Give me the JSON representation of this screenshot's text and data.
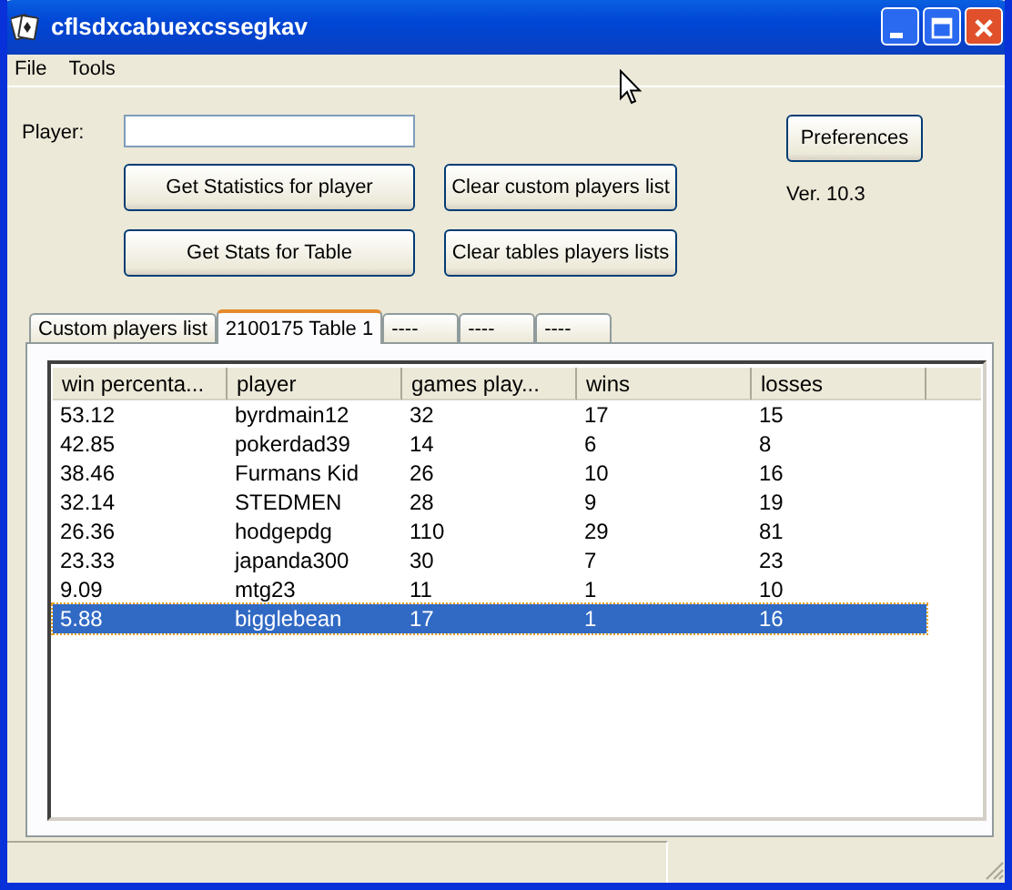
{
  "window": {
    "title": "cflsdxcabuexcssegkav"
  },
  "menu": [
    "File",
    "Tools"
  ],
  "player_field": {
    "label": "Player:"
  },
  "buttons": [
    {
      "label": "Get Statistics for player"
    },
    {
      "label": "Clear custom players list"
    },
    {
      "label": "Get Stats for Table"
    },
    {
      "label": "Clear tables players lists"
    }
  ],
  "preferences_button": "Preferences",
  "version": "Ver. 10.3",
  "tabs": [
    {
      "label": "Custom players list",
      "selected": false
    },
    {
      "label": "2100175 Table 1",
      "selected": true
    },
    {
      "label": "----",
      "selected": false
    },
    {
      "label": "----",
      "selected": false
    },
    {
      "label": "----",
      "selected": false
    }
  ],
  "table": {
    "columns": [
      "win percenta...",
      "player",
      "games play...",
      "wins",
      "losses"
    ],
    "rows": [
      {
        "cells": [
          "53.12",
          "byrdmain12",
          "32",
          "17",
          "15"
        ],
        "selected": false
      },
      {
        "cells": [
          "42.85",
          "pokerdad39",
          "14",
          "6",
          "8"
        ],
        "selected": false
      },
      {
        "cells": [
          "38.46",
          "Furmans Kid",
          "26",
          "10",
          "16"
        ],
        "selected": false
      },
      {
        "cells": [
          "32.14",
          "STEDMEN",
          "28",
          "9",
          "19"
        ],
        "selected": false
      },
      {
        "cells": [
          "26.36",
          "hodgepdg",
          "110",
          "29",
          "81"
        ],
        "selected": false
      },
      {
        "cells": [
          "23.33",
          "japanda300",
          "30",
          "7",
          "23"
        ],
        "selected": false
      },
      {
        "cells": [
          "9.09",
          "mtg23",
          "11",
          "1",
          "10"
        ],
        "selected": false
      },
      {
        "cells": [
          "5.88",
          "bigglebean",
          "17",
          "1",
          "16"
        ],
        "selected": true
      }
    ]
  }
}
